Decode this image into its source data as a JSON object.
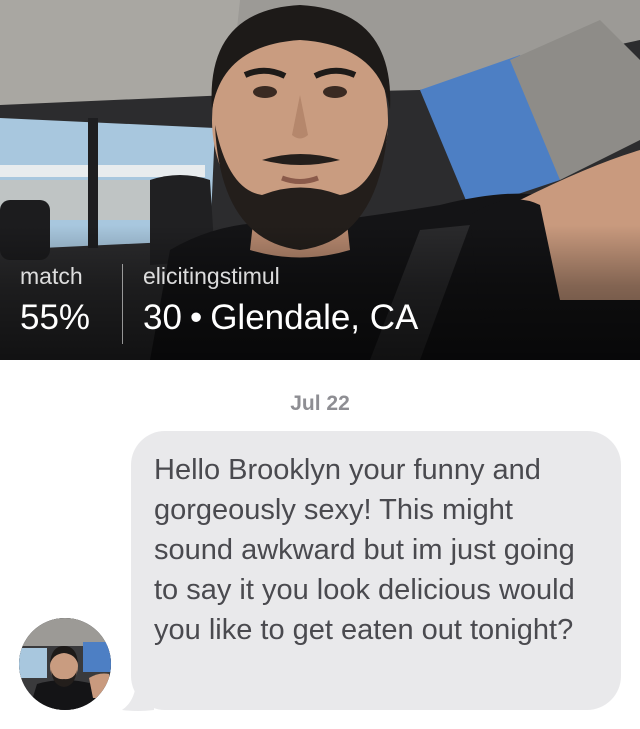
{
  "header": {
    "photo": "profile-photo",
    "match_label": "match",
    "match_value": "55%",
    "username": "elicitingstimul",
    "age": "30",
    "separator": "•",
    "location": "Glendale, CA"
  },
  "conversation": {
    "date": "Jul 22",
    "messages": [
      {
        "sender": "elicitingstimul",
        "avatar": "sender-avatar",
        "text": "Hello Brooklyn your funny and gorgeously sexy! This might sound awkward but im just going to say it you look delicious would you like to get eaten out tonight?"
      }
    ]
  },
  "colors": {
    "bubble_background": "#e9e9eb",
    "message_text": "#4a4a4f",
    "date_text": "#8e8e93",
    "header_text": "#ffffff"
  }
}
